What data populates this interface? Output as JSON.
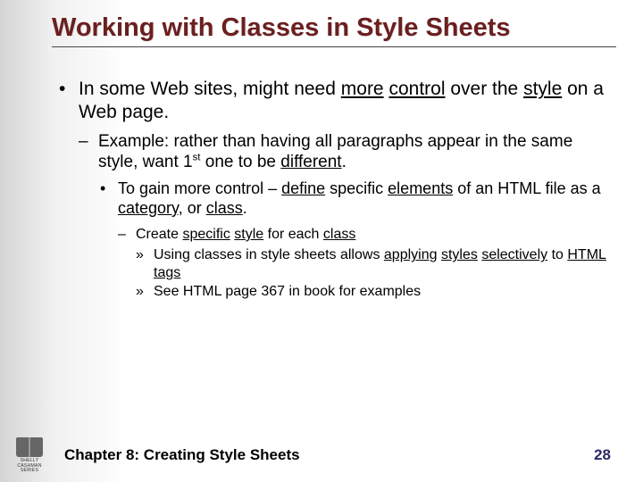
{
  "title": "Working with Classes in Style Sheets",
  "bullets": {
    "l1": {
      "pre": "In some Web sites, might need ",
      "u1": "more",
      "mid1": " ",
      "u2": "control",
      "mid2": " over the ",
      "u3": "style",
      "post": " on a Web page."
    },
    "l2": {
      "pre": "Example: rather than having all paragraphs appear in the same style, want 1",
      "sup": "st",
      "mid": " one to be ",
      "u1": "different",
      "post": "."
    },
    "l3": {
      "pre": "To gain more control – ",
      "u1": "define",
      "mid1": " specific ",
      "u2": "elements",
      "mid2": " of an HTML file as a ",
      "u3": "category",
      "mid3": ", or ",
      "u4": "class",
      "post": "."
    },
    "l4": {
      "pre": "Create ",
      "u1": "specific",
      "mid1": " ",
      "u2": "style",
      "mid2": " for each ",
      "u3": "class"
    },
    "l5a": {
      "pre": "Using classes in style sheets allows ",
      "u1": "applying",
      "mid1": " ",
      "u2": "styles",
      "mid2": " ",
      "u3": "selectively",
      "mid3": " to ",
      "u4": "HTML tags"
    },
    "l5b": "See HTML page 367 in book for examples"
  },
  "footer": {
    "chapter": "Chapter 8: Creating Style Sheets",
    "page": "28"
  },
  "logo": {
    "line1": "SHELLY",
    "line2": "CASHMAN",
    "line3": "SERIES"
  }
}
